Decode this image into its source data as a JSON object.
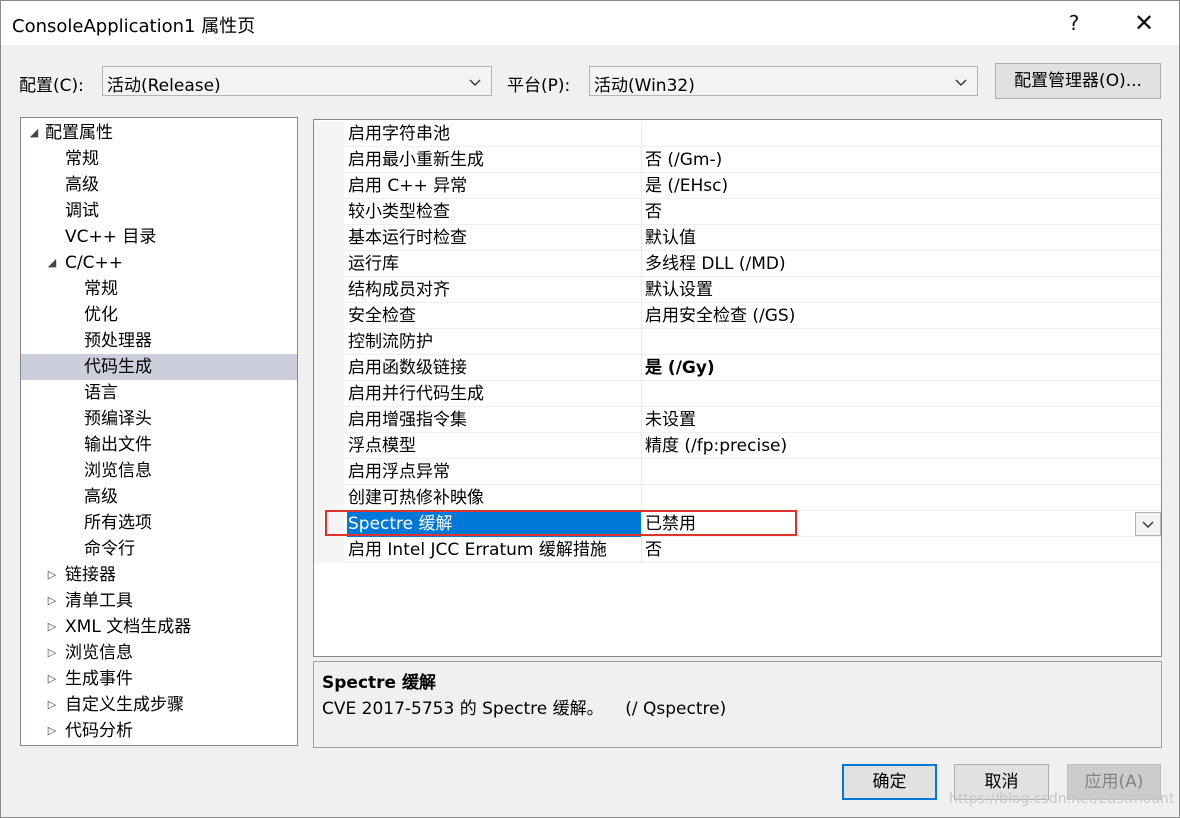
{
  "window": {
    "title": "ConsoleApplication1 属性页",
    "help_glyph": "?",
    "close_glyph": "✕"
  },
  "toolbar": {
    "config_label": "配置(C):",
    "config_value": "活动(Release)",
    "platform_label": "平台(P):",
    "platform_value": "活动(Win32)",
    "config_manager_label": "配置管理器(O)..."
  },
  "tree": {
    "items": [
      {
        "label": "配置属性",
        "twisty": "◢"
      },
      {
        "label": "常规",
        "twisty": ""
      },
      {
        "label": "高级",
        "twisty": ""
      },
      {
        "label": "调试",
        "twisty": ""
      },
      {
        "label": "VC++ 目录",
        "twisty": ""
      },
      {
        "label": "C/C++",
        "twisty": "◢"
      },
      {
        "label": "常规",
        "twisty": ""
      },
      {
        "label": "优化",
        "twisty": ""
      },
      {
        "label": "预处理器",
        "twisty": ""
      },
      {
        "label": "代码生成",
        "twisty": "",
        "selected": true
      },
      {
        "label": "语言",
        "twisty": ""
      },
      {
        "label": "预编译头",
        "twisty": ""
      },
      {
        "label": "输出文件",
        "twisty": ""
      },
      {
        "label": "浏览信息",
        "twisty": ""
      },
      {
        "label": "高级",
        "twisty": ""
      },
      {
        "label": "所有选项",
        "twisty": ""
      },
      {
        "label": "命令行",
        "twisty": ""
      },
      {
        "label": "链接器",
        "twisty": "▷"
      },
      {
        "label": "清单工具",
        "twisty": "▷"
      },
      {
        "label": "XML 文档生成器",
        "twisty": "▷"
      },
      {
        "label": "浏览信息",
        "twisty": "▷"
      },
      {
        "label": "生成事件",
        "twisty": "▷"
      },
      {
        "label": "自定义生成步骤",
        "twisty": "▷"
      },
      {
        "label": "代码分析",
        "twisty": "▷"
      }
    ]
  },
  "grid": {
    "rows": [
      {
        "name": "启用字符串池",
        "value": ""
      },
      {
        "name": "启用最小重新生成",
        "value": "否 (/Gm-)"
      },
      {
        "name": "启用 C++ 异常",
        "value": "是 (/EHsc)"
      },
      {
        "name": "较小类型检查",
        "value": "否"
      },
      {
        "name": "基本运行时检查",
        "value": "默认值"
      },
      {
        "name": "运行库",
        "value": "多线程 DLL (/MD)"
      },
      {
        "name": "结构成员对齐",
        "value": "默认设置"
      },
      {
        "name": "安全检查",
        "value": "启用安全检查 (/GS)"
      },
      {
        "name": "控制流防护",
        "value": ""
      },
      {
        "name": "启用函数级链接",
        "value": "是 (/Gy)",
        "bold": true
      },
      {
        "name": "启用并行代码生成",
        "value": ""
      },
      {
        "name": "启用增强指令集",
        "value": "未设置"
      },
      {
        "name": "浮点模型",
        "value": "精度 (/fp:precise)"
      },
      {
        "name": "启用浮点异常",
        "value": ""
      },
      {
        "name": "创建可热修补映像",
        "value": ""
      },
      {
        "name": "Spectre 缓解",
        "value": "已禁用",
        "selected": true
      },
      {
        "name": "启用 Intel JCC Erratum 缓解措施",
        "value": "否"
      }
    ]
  },
  "description": {
    "title": "Spectre 缓解",
    "text": "CVE 2017-5753 的 Spectre 缓解。    (/ Qspectre)"
  },
  "buttons": {
    "ok": "确定",
    "cancel": "取消",
    "apply": "应用(A)"
  },
  "watermark": "https://blog.csdn.net/Eastmount",
  "colors": {
    "selection": "#0078d7",
    "tree_selection": "#cccedb",
    "highlight_box": "#e0322c",
    "ok_border": "#0078d7"
  }
}
